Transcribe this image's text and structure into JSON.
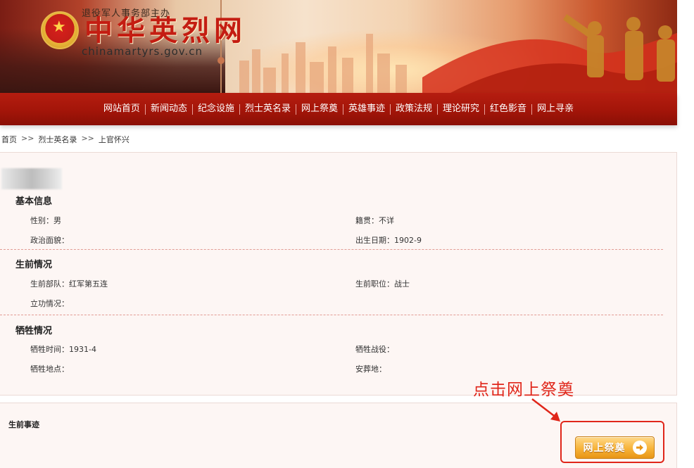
{
  "header": {
    "owner_text": "退役军人事务部主办",
    "site_title": "中华英烈网",
    "domain": "chinamartyrs.gov.cn"
  },
  "nav": {
    "items": [
      {
        "label": "网站首页"
      },
      {
        "label": "新闻动态"
      },
      {
        "label": "纪念设施"
      },
      {
        "label": "烈士英名录"
      },
      {
        "label": "网上祭奠"
      },
      {
        "label": "英雄事迹"
      },
      {
        "label": "政策法规"
      },
      {
        "label": "理论研究"
      },
      {
        "label": "红色影音"
      },
      {
        "label": "网上寻亲"
      }
    ]
  },
  "breadcrumb": {
    "home": "首页",
    "separator": ">>",
    "list": "烈士英名录",
    "current": "上官怀兴"
  },
  "basic_info": {
    "title": "基本信息",
    "gender_label": "性别：",
    "gender_value": "男",
    "native_label": "籍贯：",
    "native_value": "不详",
    "political_label": "政治面貌：",
    "political_value": "",
    "birth_label": "出生日期：",
    "birth_value": "1902-9"
  },
  "life_info": {
    "title": "生前情况",
    "unit_label": "生前部队：",
    "unit_value": "红军第五连",
    "position_label": "生前职位：",
    "position_value": "战士",
    "merit_label": "立功情况：",
    "merit_value": ""
  },
  "sacrifice_info": {
    "title": "牺牲情况",
    "time_label": "牺牲时间：",
    "time_value": "1931-4",
    "battle_label": "牺牲战役：",
    "battle_value": "",
    "place_label": "牺牲地点：",
    "place_value": "",
    "burial_label": "安葬地：",
    "burial_value": ""
  },
  "deeds": {
    "title": "生前事迹",
    "tribute_button": "网上祭奠"
  },
  "annotation": {
    "text": "点击网上祭奠",
    "color": "#e0261a"
  },
  "colors": {
    "nav_red": "#a31509",
    "panel_bg": "#fdf6f4",
    "button_orange": "#f7b339"
  }
}
